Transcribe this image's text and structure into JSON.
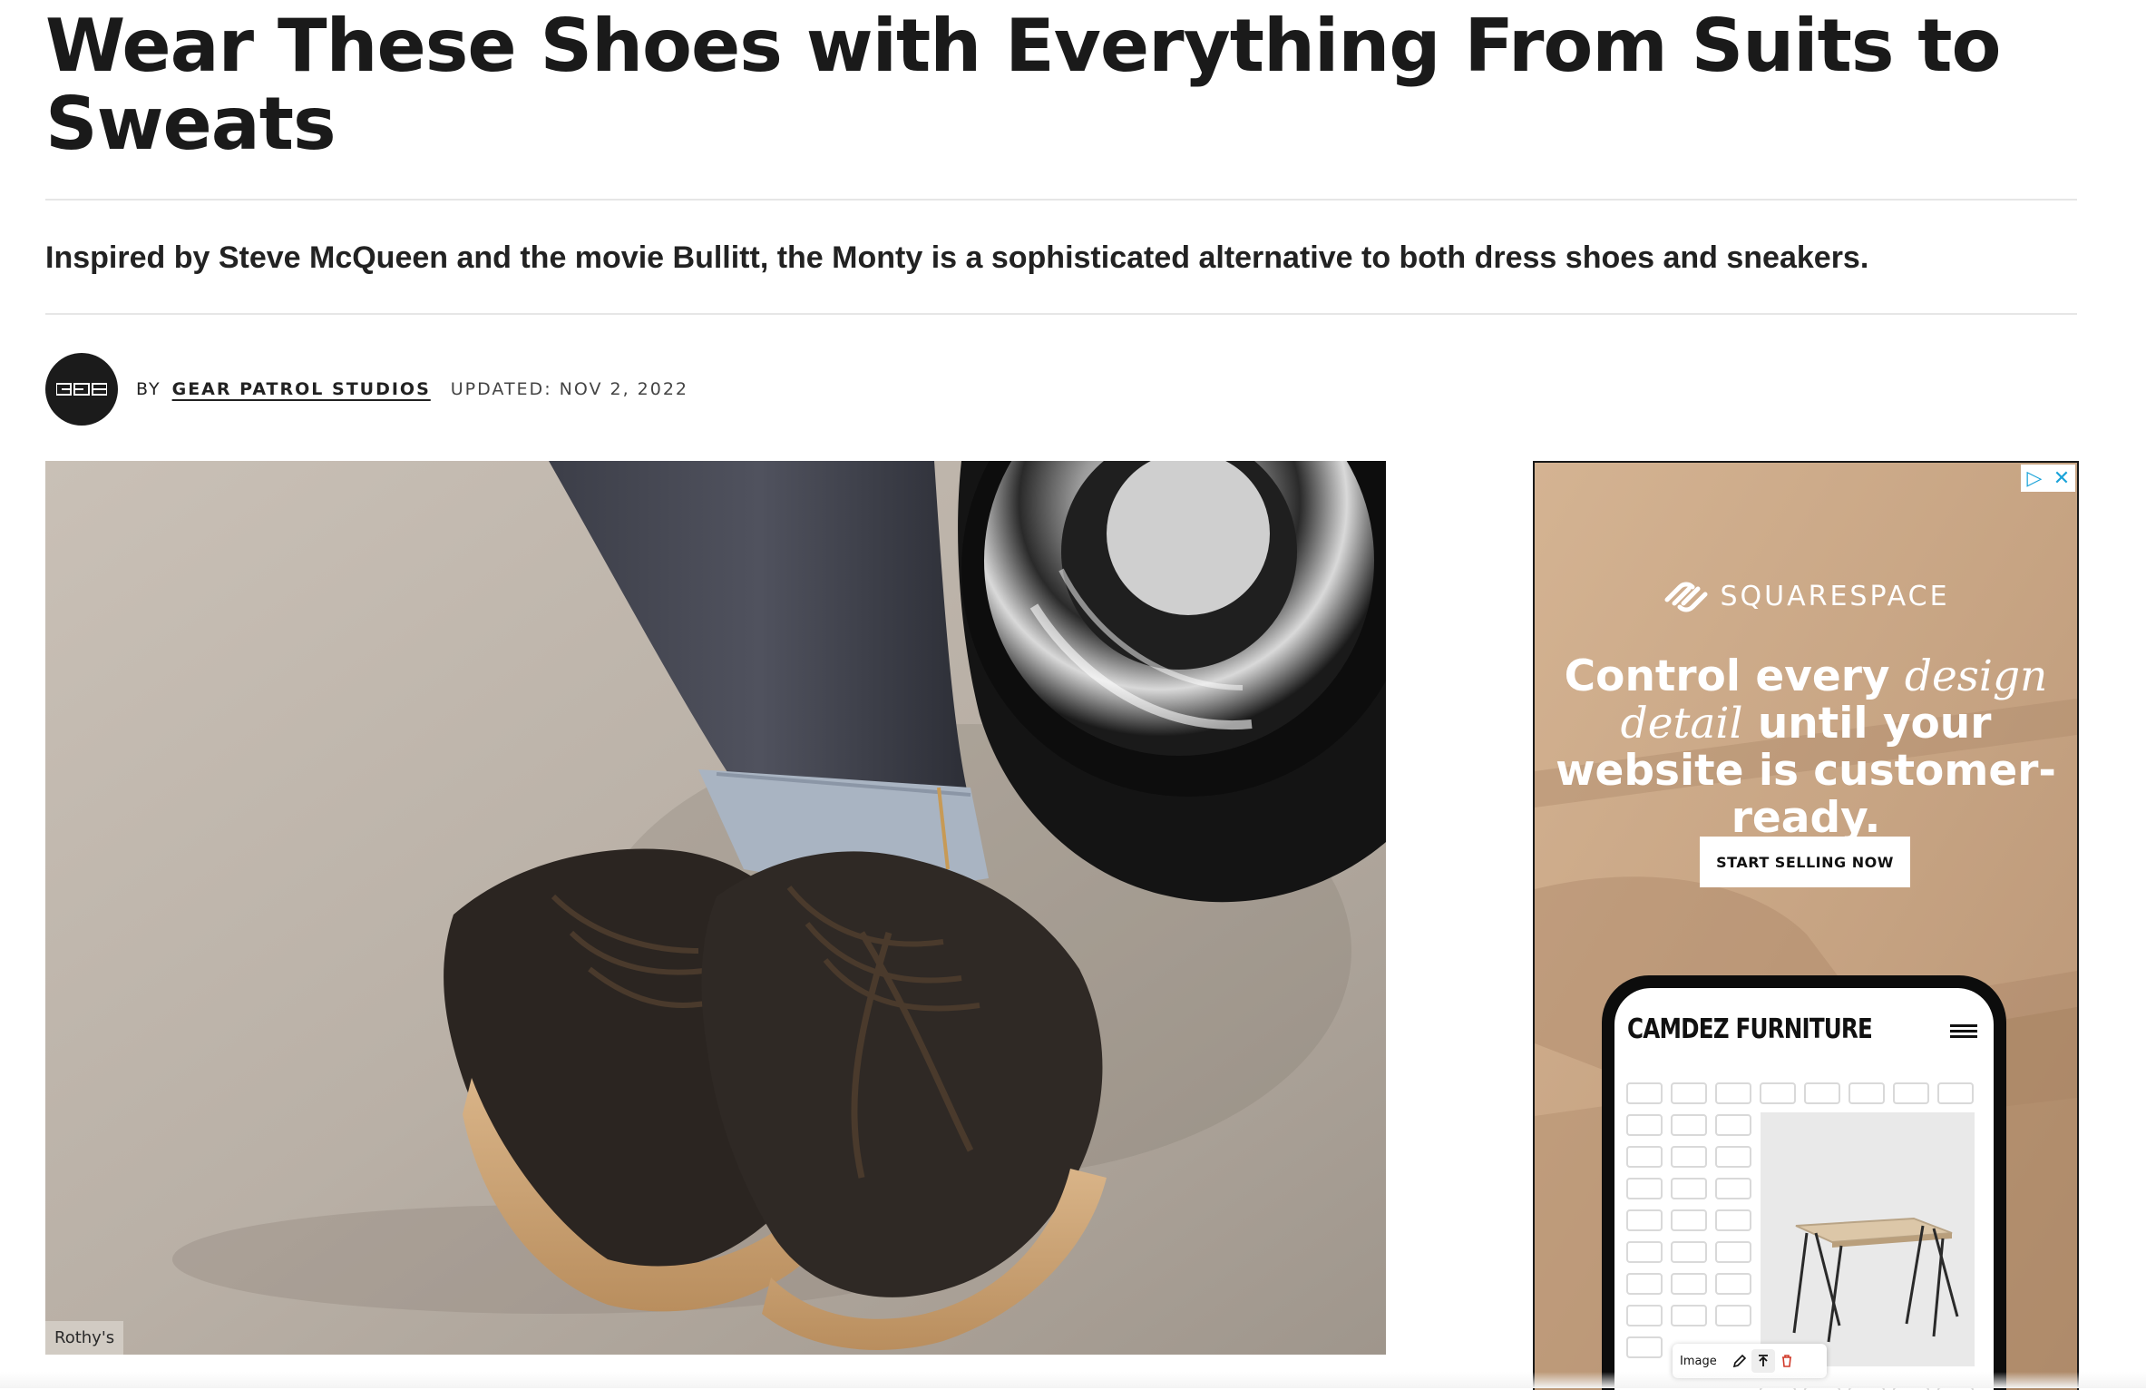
{
  "article": {
    "headline": "Wear These Shoes with Everything From Suits to Sweats",
    "dek": "Inspired by Steve McQueen and the movie Bullitt, the Monty is a sophisticated alternative to both dress shoes and sneakers.",
    "byline": {
      "prefix": "BY",
      "author": "GEAR PATROL STUDIOS",
      "updated": "UPDATED: NOV 2, 2022",
      "avatar_icon": "gear-patrol-studios-logo"
    },
    "hero": {
      "credit": "Rothy's"
    }
  },
  "ad": {
    "choices_icons": [
      "ad-choices-icon",
      "close-icon"
    ],
    "brand": "SQUARESPACE",
    "headline": {
      "part1": "Control every ",
      "part2_italic": "design",
      "part3_italic": "detail",
      "part4": " until your website is customer-ready."
    },
    "cta": "START SELLING NOW",
    "phone": {
      "site_title": "CAMDEZ FURNITURE",
      "toolbar_label": "Image"
    }
  },
  "colors": {
    "text": "#1a1a1a",
    "rule": "#e6e6e6",
    "ad_accent": "#1aa3d9",
    "delete_red": "#d13a2a"
  }
}
